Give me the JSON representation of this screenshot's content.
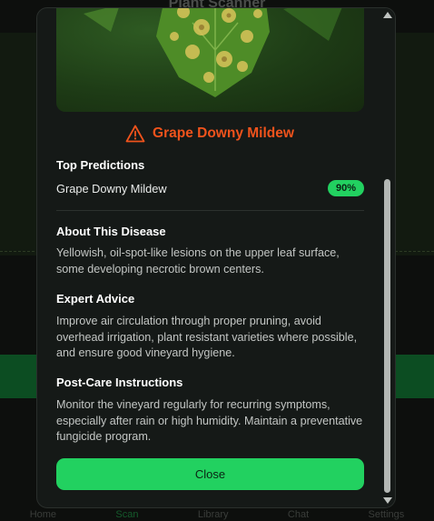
{
  "background": {
    "title": "Plant Scanner",
    "nav": [
      "Home",
      "Scan",
      "Library",
      "Chat",
      "Settings"
    ],
    "active_nav": "Scan"
  },
  "modal": {
    "disease_name": "Grape Downy Mildew",
    "top_predictions": {
      "title": "Top Predictions",
      "items": [
        {
          "label": "Grape Downy Mildew",
          "confidence": "90%"
        }
      ]
    },
    "about": {
      "title": "About This Disease",
      "text": "Yellowish, oil-spot-like lesions on the upper leaf surface, some developing necrotic brown centers."
    },
    "advice": {
      "title": "Expert Advice",
      "text": "Improve air circulation through proper pruning, avoid overhead irrigation, plant resistant varieties where possible, and ensure good vineyard hygiene."
    },
    "post_care": {
      "title": "Post-Care Instructions",
      "text": "Monitor the vineyard regularly for recurring symptoms, especially after rain or high humidity. Maintain a preventative fungicide program."
    },
    "close_label": "Close"
  },
  "colors": {
    "accent": "#22d160",
    "warning": "#f0531c",
    "modal_bg": "#151917"
  },
  "icons": {
    "warning": "warning-triangle-icon",
    "scroll_up": "scroll-up-arrow",
    "scroll_down": "scroll-down-arrow"
  }
}
